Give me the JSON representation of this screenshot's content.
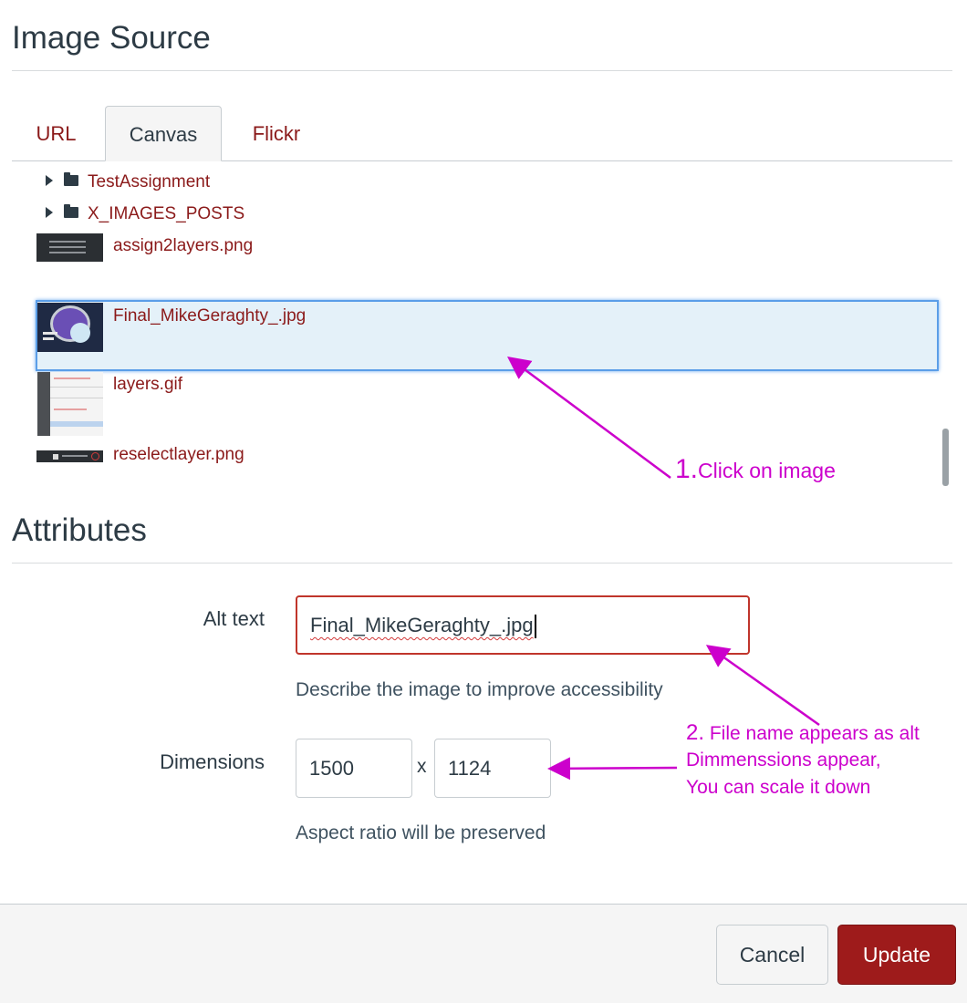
{
  "image_source": {
    "heading": "Image Source",
    "tabs": [
      {
        "label": "URL",
        "active": false
      },
      {
        "label": "Canvas",
        "active": true
      },
      {
        "label": "Flickr",
        "active": false
      }
    ],
    "tree": {
      "folders": [
        {
          "label": "TestAssignment",
          "icon": "folder-icon"
        },
        {
          "label": "X_IMAGES_POSTS",
          "icon": "folder-icon"
        }
      ],
      "files": [
        {
          "label": "assign2layers.png",
          "selected": false
        },
        {
          "label": "Final_MikeGeraghty_.jpg",
          "selected": true
        },
        {
          "label": "layers.gif",
          "selected": false
        },
        {
          "label": "reselectlayer.png",
          "selected": false
        }
      ]
    }
  },
  "attributes": {
    "heading": "Attributes",
    "alt_text": {
      "label": "Alt text",
      "value": "Final_MikeGeraghty_.jpg",
      "help": "Describe the image to improve accessibility"
    },
    "dimensions": {
      "label": "Dimensions",
      "width": "1500",
      "separator": "x",
      "height": "1124",
      "help": "Aspect ratio will be preserved"
    }
  },
  "footer": {
    "cancel_label": "Cancel",
    "update_label": "Update"
  },
  "annotations": {
    "step1_number": "1.",
    "step1_text": "Click on image",
    "step2_number": "2.",
    "step2_line1": "File name appears as alt",
    "step2_line2": "Dimmenssions appear,",
    "step2_line3": "You can scale it down"
  },
  "colors": {
    "link": "#8b1a1a",
    "primary_button": "#9e1b1b",
    "annotation": "#cc00cc",
    "selection": "#e4f1f9",
    "error_border": "#c0352b"
  }
}
